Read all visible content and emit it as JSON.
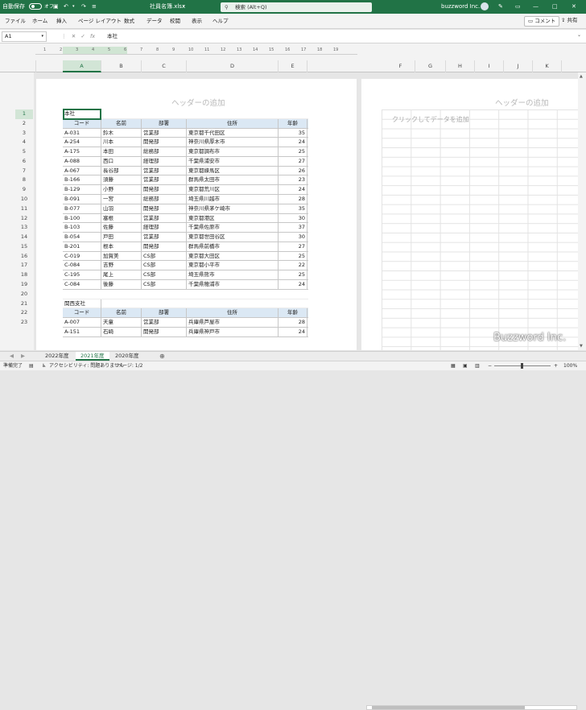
{
  "titlebar": {
    "autosave_label": "自動保存",
    "autosave_state": "オフ",
    "filename": "社員名簿.xlsx",
    "search_placeholder": "検索 (Alt+Q)",
    "user": "buzzword Inc."
  },
  "menu": {
    "items": [
      "ファイル",
      "ホーム",
      "挿入",
      "ページ レイアウト",
      "数式",
      "データ",
      "校閲",
      "表示",
      "ヘルプ"
    ],
    "comment_label": "コメント",
    "share_label": "共有"
  },
  "formula": {
    "namebox": "A1",
    "fx": "fx",
    "content": "本社"
  },
  "ruler_numbers": [
    "1",
    "2",
    "3",
    "4",
    "5",
    "6",
    "7",
    "8",
    "9",
    "10",
    "11",
    "12",
    "13",
    "14",
    "15",
    "16",
    "17",
    "18",
    "19"
  ],
  "columns": [
    "A",
    "B",
    "C",
    "D",
    "E",
    "F",
    "G",
    "H",
    "I",
    "J",
    "K"
  ],
  "row_numbers": [
    "1",
    "2",
    "3",
    "4",
    "5",
    "6",
    "7",
    "8",
    "9",
    "10",
    "11",
    "12",
    "13",
    "14",
    "15",
    "16",
    "17",
    "18",
    "19",
    "20",
    "21",
    "22",
    "23"
  ],
  "page": {
    "header_placeholder": "ヘッダーの追加",
    "header_placeholder_right": "ヘッダーの追加",
    "add_data": "クリックしてデータを追加"
  },
  "sheet": {
    "section1_title": "本社",
    "section2_title": "関西支社",
    "headers": [
      "コード",
      "名前",
      "部署",
      "住所",
      "年齢"
    ],
    "rows": [
      [
        "A-031",
        "鈴木",
        "営業部",
        "東京都千代田区",
        "35"
      ],
      [
        "A-254",
        "川本",
        "開発部",
        "神奈川県厚木市",
        "24"
      ],
      [
        "A-175",
        "本田",
        "総務部",
        "東京都調布市",
        "25"
      ],
      [
        "A-088",
        "西口",
        "経理部",
        "千葉県浦安市",
        "27"
      ],
      [
        "A-067",
        "長谷部",
        "営業部",
        "東京都練馬区",
        "26"
      ],
      [
        "B-166",
        "須藤",
        "営業部",
        "群馬県太田市",
        "23"
      ],
      [
        "B-129",
        "小野",
        "開発部",
        "東京都荒川区",
        "24"
      ],
      [
        "B-091",
        "一宮",
        "総務部",
        "埼玉県川越市",
        "28"
      ],
      [
        "B-077",
        "山羽",
        "開発部",
        "神奈川県茅ケ崎市",
        "35"
      ],
      [
        "B-100",
        "塞根",
        "営業部",
        "東京都港区",
        "30"
      ],
      [
        "B-103",
        "佐藤",
        "経理部",
        "千葉県佐原市",
        "37"
      ],
      [
        "B-054",
        "戸田",
        "営業部",
        "東京都世田谷区",
        "30"
      ],
      [
        "B-201",
        "根本",
        "開発部",
        "群馬県前橋市",
        "27"
      ],
      [
        "C-019",
        "加賀美",
        "CS部",
        "東京都大田区",
        "25"
      ],
      [
        "C-084",
        "吉野",
        "CS部",
        "東京都小平市",
        "22"
      ],
      [
        "C-195",
        "尾上",
        "CS部",
        "埼玉県熊市",
        "25"
      ],
      [
        "C-084",
        "後藤",
        "CS部",
        "千葉県穂浦市",
        "24"
      ]
    ],
    "rows2": [
      [
        "A-007",
        "天童",
        "営業部",
        "兵庫県芦屋市",
        "28"
      ],
      [
        "A-151",
        "石崎",
        "開発部",
        "兵庫県神戸市",
        "24"
      ]
    ]
  },
  "tabs": [
    "2022年度",
    "2021年度",
    "2020年度"
  ],
  "active_tab": "2021年度",
  "status": {
    "ready": "準備完了",
    "accessibility": "アクセシビリティ: 問題ありません",
    "page": "ページ: 1/2",
    "zoom": "100%"
  },
  "watermark": "Buzzword Inc.",
  "colors": {
    "accent": "#217346",
    "header_fill": "#dbe8f4"
  }
}
